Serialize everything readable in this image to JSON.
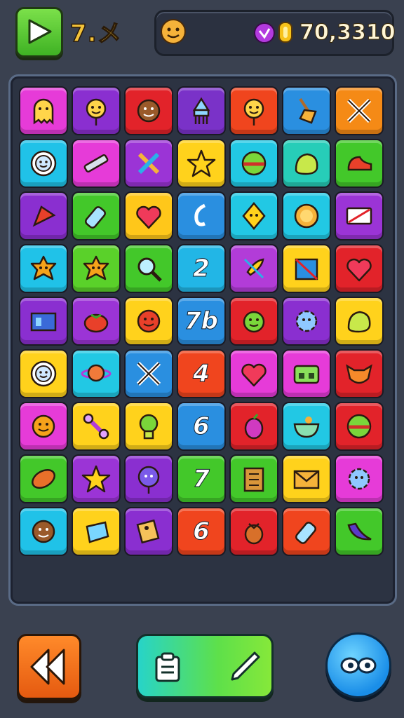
{
  "header": {
    "level_label": "7.メ",
    "score": "70,3310"
  },
  "board": {
    "tiles": [
      [
        {
          "color": "#e63bd8",
          "icon": "smiley-ghost-icon"
        },
        {
          "color": "#8a2fd0",
          "icon": "smiley-balloon-icon"
        },
        {
          "color": "#e2232a",
          "icon": "smiley-brown-icon"
        },
        {
          "color": "#7a32c8",
          "icon": "squid-icon"
        },
        {
          "color": "#f0451e",
          "icon": "smiley-balloon-icon"
        },
        {
          "color": "#2a8fe0",
          "icon": "broom-icon"
        },
        {
          "color": "#f58a16",
          "icon": "crossed-swords-icon"
        }
      ],
      [
        {
          "color": "#20c2e8",
          "icon": "sun-face-icon"
        },
        {
          "color": "#e63bd8",
          "icon": "pen-icon"
        },
        {
          "color": "#9b34d6",
          "icon": "crossed-pencils-icon"
        },
        {
          "color": "#ffd21c",
          "icon": "star-icon"
        },
        {
          "color": "#22c8e4",
          "icon": "ball-icon"
        },
        {
          "color": "#27cdb8",
          "icon": "blob-icon"
        },
        {
          "color": "#43c82a",
          "icon": "shoe-icon"
        }
      ],
      [
        {
          "color": "#8a2fd0",
          "icon": "flag-icon"
        },
        {
          "color": "#43c82a",
          "icon": "bottle-icon"
        },
        {
          "color": "#ffc71a",
          "icon": "heart-icon"
        },
        {
          "color": "#2a8fe0",
          "icon": "hook-icon"
        },
        {
          "color": "#22c8e4",
          "icon": "diamond-face-icon"
        },
        {
          "color": "#22c8e4",
          "icon": "coin-icon"
        },
        {
          "color": "#9b34d6",
          "icon": "card-icon"
        }
      ],
      [
        {
          "color": "#20c2e8",
          "icon": "star-blob-icon"
        },
        {
          "color": "#5ad12a",
          "icon": "star-blob-icon"
        },
        {
          "color": "#43c82a",
          "icon": "magnifier-icon"
        },
        {
          "color": "#22b6e6",
          "icon": "number-2-icon",
          "num": "2"
        },
        {
          "color": "#b23cd8",
          "icon": "rocket-icon"
        },
        {
          "color": "#ffd21c",
          "icon": "box-icon"
        },
        {
          "color": "#e2232a",
          "icon": "heart-icon"
        }
      ],
      [
        {
          "color": "#8a2fd0",
          "icon": "window-icon"
        },
        {
          "color": "#9b34d6",
          "icon": "tomato-icon"
        },
        {
          "color": "#ffd21c",
          "icon": "smiley-red-icon"
        },
        {
          "color": "#2a8fe0",
          "icon": "number-7-icon",
          "num": "7b"
        },
        {
          "color": "#e2232a",
          "icon": "smiley-green-icon"
        },
        {
          "color": "#8a2fd0",
          "icon": "gear-face-icon"
        },
        {
          "color": "#ffd21c",
          "icon": "blob-icon"
        }
      ],
      [
        {
          "color": "#ffd21c",
          "icon": "sun-face-icon"
        },
        {
          "color": "#22c8e4",
          "icon": "planet-icon"
        },
        {
          "color": "#2a8fe0",
          "icon": "crossed-swords-icon"
        },
        {
          "color": "#f0451e",
          "icon": "number-4-icon",
          "num": "4"
        },
        {
          "color": "#e63bd8",
          "icon": "heart-icon"
        },
        {
          "color": "#e63bd8",
          "icon": "radio-icon"
        },
        {
          "color": "#e2232a",
          "icon": "fox-face-icon"
        }
      ],
      [
        {
          "color": "#e63bd8",
          "icon": "smiley-orange-icon"
        },
        {
          "color": "#ffd21c",
          "icon": "wrench-icon"
        },
        {
          "color": "#ffd21c",
          "icon": "bulb-icon"
        },
        {
          "color": "#2a8fe0",
          "icon": "number-6-icon",
          "num": "6"
        },
        {
          "color": "#e2232a",
          "icon": "berry-icon"
        },
        {
          "color": "#22c8e4",
          "icon": "bowl-icon"
        },
        {
          "color": "#e2232a",
          "icon": "ball-icon"
        }
      ],
      [
        {
          "color": "#43c82a",
          "icon": "leaf-icon"
        },
        {
          "color": "#9b34d6",
          "icon": "star-icon"
        },
        {
          "color": "#8a2fd0",
          "icon": "balloon-face-icon"
        },
        {
          "color": "#43c82a",
          "icon": "number-7-icon",
          "num": "7"
        },
        {
          "color": "#43c82a",
          "icon": "scroll-icon"
        },
        {
          "color": "#ffd21c",
          "icon": "envelope-icon"
        },
        {
          "color": "#e63bd8",
          "icon": "gear-face-icon"
        }
      ],
      [
        {
          "color": "#20c2e8",
          "icon": "smiley-brown-icon"
        },
        {
          "color": "#ffd21c",
          "icon": "gem-icon"
        },
        {
          "color": "#8a2fd0",
          "icon": "cheese-icon"
        },
        {
          "color": "#f0451e",
          "icon": "number-6-icon",
          "num": "6"
        },
        {
          "color": "#e2232a",
          "icon": "acorn-icon"
        },
        {
          "color": "#f0451e",
          "icon": "bottle-icon"
        },
        {
          "color": "#43c82a",
          "icon": "banana-icon"
        }
      ]
    ]
  },
  "controls": {
    "back_icon": "double-back-arrow-icon",
    "action_icons": [
      "clipboard-icon",
      "pen-icon"
    ],
    "menu_icon": "eyes-icon"
  },
  "colors": {
    "background": "#3a4150",
    "accent_gold": "#f5c43a"
  }
}
